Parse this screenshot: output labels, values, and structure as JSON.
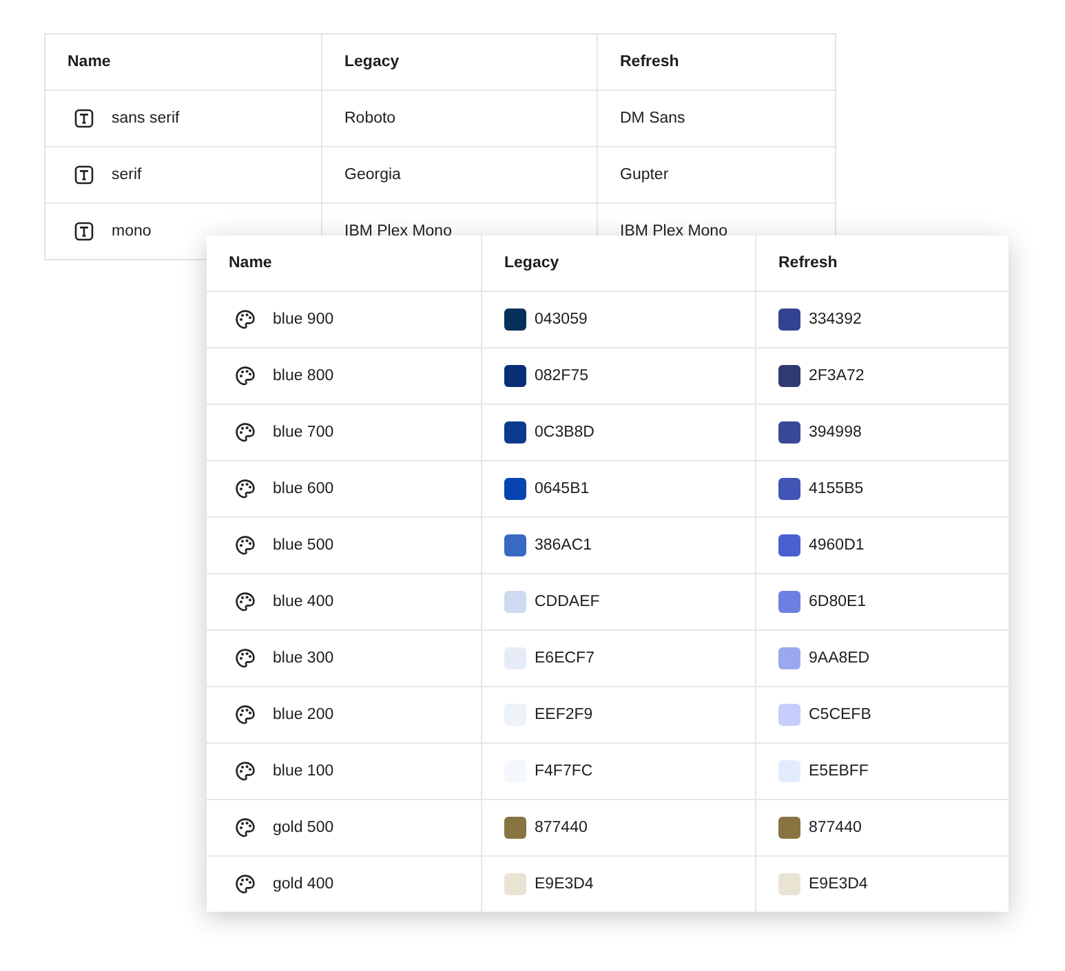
{
  "fonts_table": {
    "columns": [
      "Name",
      "Legacy",
      "Refresh"
    ],
    "rows": [
      {
        "name": "sans serif",
        "legacy": "Roboto",
        "refresh": "DM Sans"
      },
      {
        "name": "serif",
        "legacy": "Georgia",
        "refresh": "Gupter"
      },
      {
        "name": "mono",
        "legacy": "IBM Plex Mono",
        "refresh": "IBM Plex Mono"
      }
    ]
  },
  "colors_table": {
    "columns": [
      "Name",
      "Legacy",
      "Refresh"
    ],
    "rows": [
      {
        "name": "blue 900",
        "legacy": {
          "hex": "043059",
          "color": "#043059"
        },
        "refresh": {
          "hex": "334392",
          "color": "#334392"
        }
      },
      {
        "name": "blue 800",
        "legacy": {
          "hex": "082F75",
          "color": "#082f75"
        },
        "refresh": {
          "hex": "2F3A72",
          "color": "#2f3a72"
        }
      },
      {
        "name": "blue 700",
        "legacy": {
          "hex": "0C3B8D",
          "color": "#0c3b8d"
        },
        "refresh": {
          "hex": "394998",
          "color": "#394998"
        }
      },
      {
        "name": "blue 600",
        "legacy": {
          "hex": "0645B1",
          "color": "#0645b1"
        },
        "refresh": {
          "hex": "4155B5",
          "color": "#4155b5"
        }
      },
      {
        "name": "blue 500",
        "legacy": {
          "hex": "386AC1",
          "color": "#386ac1"
        },
        "refresh": {
          "hex": "4960D1",
          "color": "#4960d1"
        }
      },
      {
        "name": "blue 400",
        "legacy": {
          "hex": "CDDAEF",
          "color": "#cddaef"
        },
        "refresh": {
          "hex": "6D80E1",
          "color": "#6d80e1"
        }
      },
      {
        "name": "blue 300",
        "legacy": {
          "hex": "E6ECF7",
          "color": "#e6ecf7"
        },
        "refresh": {
          "hex": "9AA8ED",
          "color": "#9aa8ed"
        }
      },
      {
        "name": "blue 200",
        "legacy": {
          "hex": "EEF2F9",
          "color": "#eef2f9"
        },
        "refresh": {
          "hex": "C5CEFB",
          "color": "#c5cefb"
        }
      },
      {
        "name": "blue 100",
        "legacy": {
          "hex": "F4F7FC",
          "color": "#f4f7fc"
        },
        "refresh": {
          "hex": "E5EBFF",
          "color": "#e5ebff"
        }
      },
      {
        "name": "gold 500",
        "legacy": {
          "hex": "877440",
          "color": "#877440"
        },
        "refresh": {
          "hex": "877440",
          "color": "#877440"
        }
      },
      {
        "name": "gold 400",
        "legacy": {
          "hex": "E9E3D4",
          "color": "#e9e3d4"
        },
        "refresh": {
          "hex": "E9E3D4",
          "color": "#e9e3d4"
        }
      }
    ]
  }
}
